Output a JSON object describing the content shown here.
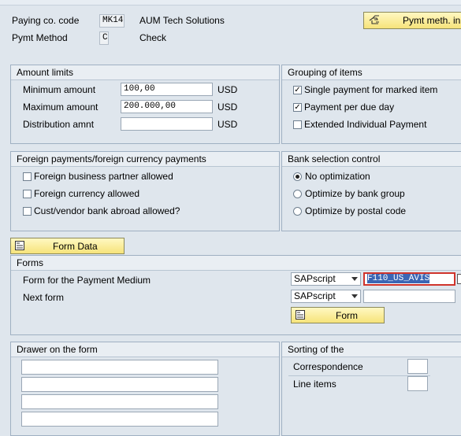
{
  "header": {
    "paying_co_code_label": "Paying co. code",
    "paying_co_code_value": "MK14",
    "company_name": "AUM Tech Solutions",
    "pymt_method_label": "Pymt Method",
    "pymt_method_value": "C",
    "pymt_method_desc": "Check",
    "pymt_meth_button": "Pymt meth. in"
  },
  "amount_limits": {
    "title": "Amount limits",
    "rows": [
      {
        "label": "Minimum amount",
        "value": "100,00",
        "currency": "USD"
      },
      {
        "label": "Maximum amount",
        "value": "200.000,00",
        "currency": "USD"
      },
      {
        "label": "Distribution amnt",
        "value": "",
        "currency": "USD"
      }
    ]
  },
  "grouping": {
    "title": "Grouping of items",
    "items": [
      {
        "label": "Single payment for marked item",
        "checked": true
      },
      {
        "label": "Payment per due day",
        "checked": true
      },
      {
        "label": "Extended Individual Payment",
        "checked": false
      }
    ]
  },
  "foreign": {
    "title": "Foreign payments/foreign currency payments",
    "items": [
      {
        "label": "Foreign business partner allowed",
        "checked": false
      },
      {
        "label": "Foreign currency allowed",
        "checked": false
      },
      {
        "label": "Cust/vendor bank abroad allowed?",
        "checked": false
      }
    ]
  },
  "bank_selection": {
    "title": "Bank selection control",
    "options": [
      {
        "label": "No optimization",
        "selected": true
      },
      {
        "label": "Optimize by bank group",
        "selected": false
      },
      {
        "label": "Optimize by postal code",
        "selected": false
      }
    ]
  },
  "form_data_button": "Form Data",
  "forms": {
    "title": "Forms",
    "payment_medium_label": "Form for the Payment Medium",
    "payment_medium_type": "SAPscript",
    "payment_medium_value": "F110_US_AVIS",
    "next_form_label": "Next form",
    "next_form_type": "SAPscript",
    "next_form_value": "",
    "form_button": "Form"
  },
  "drawer": {
    "title": "Drawer on the form"
  },
  "sorting": {
    "title": "Sorting of the",
    "correspondence_label": "Correspondence",
    "correspondence_value": "",
    "line_items_label": "Line items",
    "line_items_value": ""
  },
  "colors": {
    "background": "#dfe6ed",
    "button_yellow": "#f6e37a",
    "focus_border": "#d0342c"
  }
}
